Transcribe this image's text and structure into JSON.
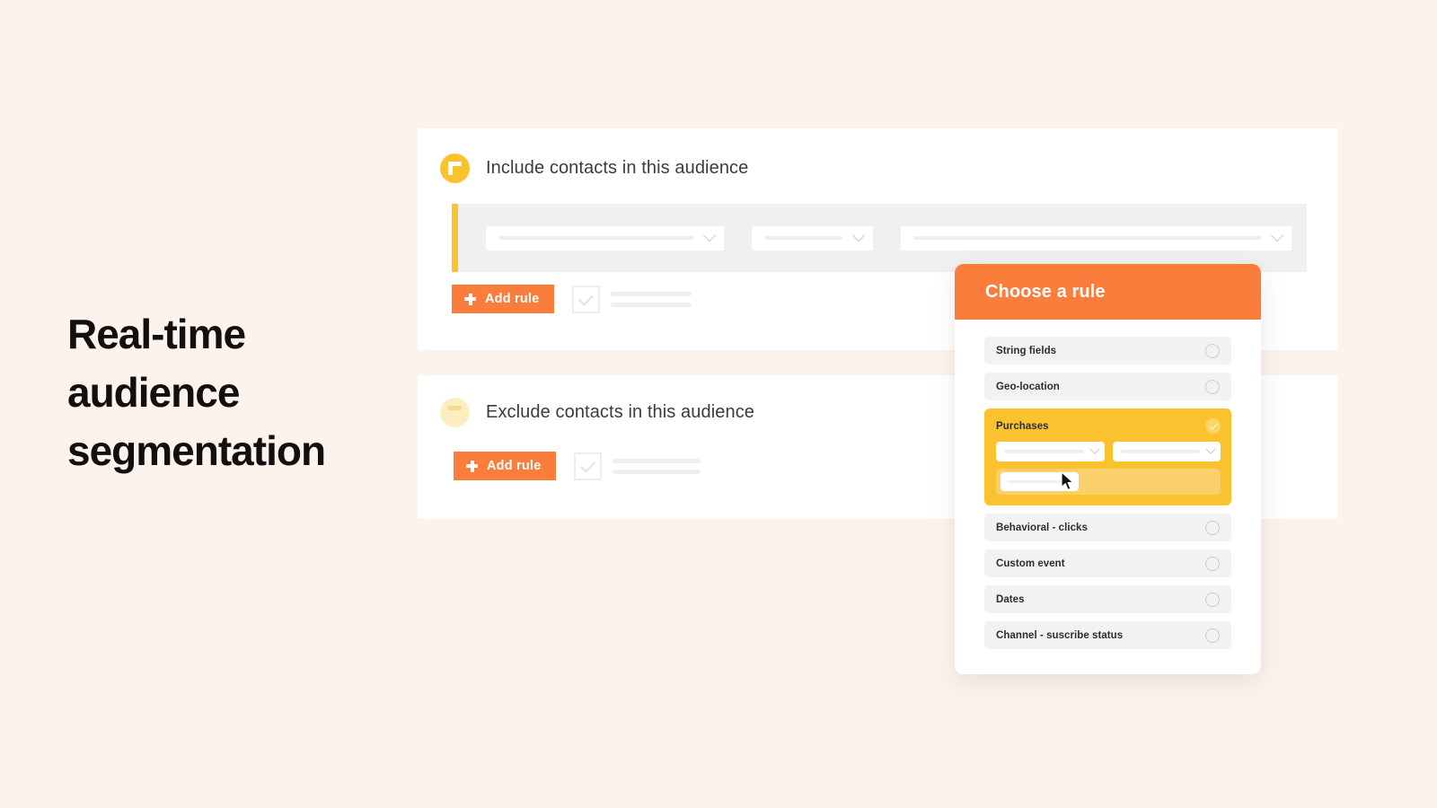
{
  "headline": {
    "line1": "Real-time",
    "line2": "audience",
    "line3": "segmentation"
  },
  "include_card": {
    "badge_icon": "plus-icon",
    "title": "Include contacts in this audience",
    "add_rule_label": "Add rule",
    "add_rule_icon": "plus-icon",
    "checkbox_icon": "checkmark-icon",
    "rule_row": {
      "accent_color": "#f9c22e",
      "field_1_icon": "chevron-down-icon",
      "field_2_icon": "chevron-down-icon",
      "field_3_icon": "chevron-down-icon"
    }
  },
  "exclude_card": {
    "badge_icon": "minus-icon",
    "title": "Exclude contacts in this audience",
    "add_rule_label": "Add rule",
    "add_rule_icon": "plus-icon",
    "checkbox_icon": "checkmark-icon"
  },
  "rule_panel": {
    "title": "Choose a rule",
    "header_color": "#fb7d3c",
    "selected_color": "#f9c22e",
    "options": [
      {
        "label": "String fields",
        "selected": false,
        "radio_icon": "radio-empty-icon"
      },
      {
        "label": "Geo-location",
        "selected": false,
        "radio_icon": "radio-empty-icon"
      },
      {
        "label": "Purchases",
        "selected": true,
        "radio_icon": "radio-checked-icon"
      },
      {
        "label": "Behavioral - clicks",
        "selected": false,
        "radio_icon": "radio-empty-icon"
      },
      {
        "label": "Custom event",
        "selected": false,
        "radio_icon": "radio-empty-icon"
      },
      {
        "label": "Dates",
        "selected": false,
        "radio_icon": "radio-empty-icon"
      },
      {
        "label": "Channel - suscribe status",
        "selected": false,
        "radio_icon": "radio-empty-icon"
      }
    ],
    "selected_detail": {
      "field_1_icon": "chevron-down-icon",
      "field_2_icon": "chevron-down-icon",
      "cursor_icon": "mouse-cursor-icon"
    }
  }
}
